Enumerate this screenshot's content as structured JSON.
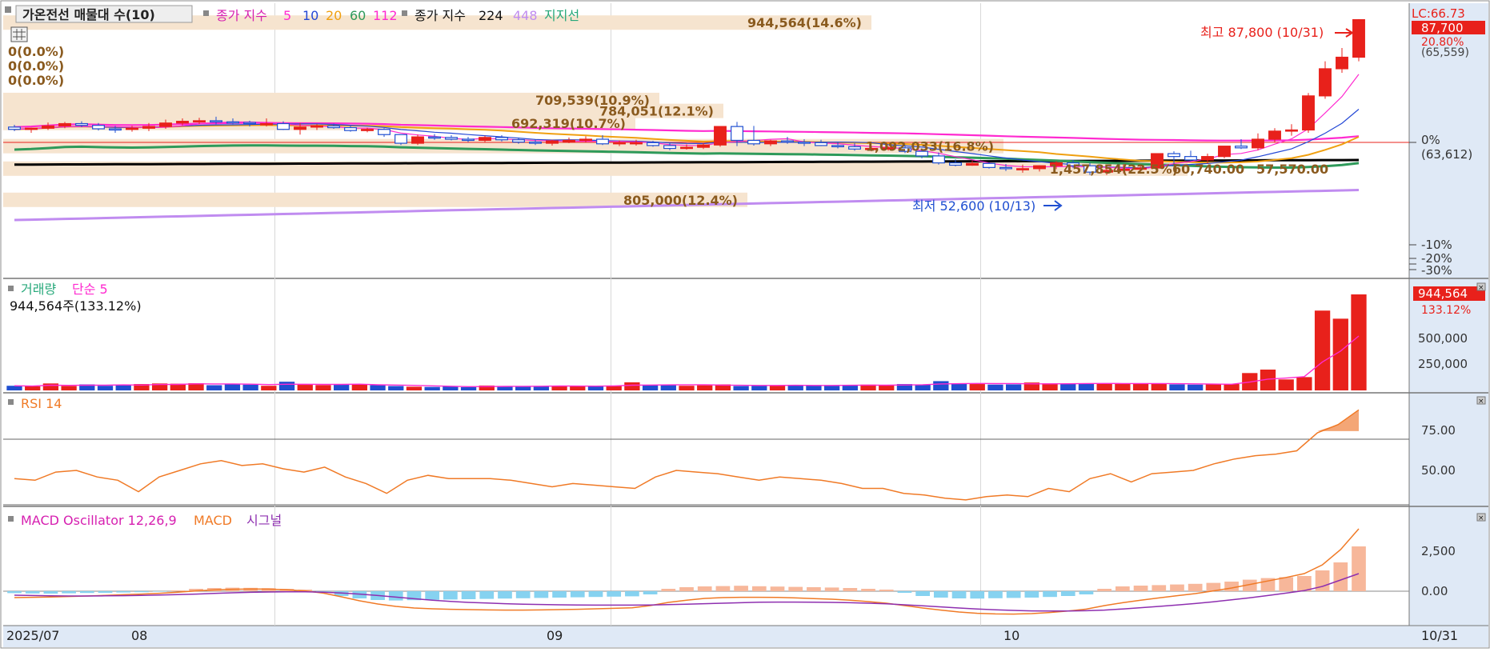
{
  "colors": {
    "up": "#e8211b",
    "down": "#1f4fd1",
    "ma5": "#ff2ad0",
    "ma10": "#2448d6",
    "ma20": "#f0a010",
    "ma60": "#2e9a5a",
    "ma112": "#ff2ad0",
    "ma224": "#000000",
    "ma448": "#c08cf0",
    "support": "#26a87a",
    "vp_band": "#f6e4cf",
    "vp_text": "#8a5a1e",
    "rsi": "#f07a26",
    "rsi_fill": "#f4a676",
    "macd": "#f07a26",
    "signal": "#8e2fb0",
    "osc_pos": "#f7b79a",
    "osc_neg": "#86d2f0",
    "axis_bg": "#dfe9f6"
  },
  "price_panel": {
    "legend": {
      "title": "가온전선 매물대 수(10)",
      "ma_label_a": "종가 지수",
      "ma_vals_a": [
        "5",
        "10",
        "20",
        "60",
        "112"
      ],
      "ma_label_b": "종가 지수",
      "ma_vals_b": [
        "224",
        "448"
      ],
      "support_label": "지지선"
    },
    "grid_icon": "grid-icon",
    "zero_rows": [
      "0(0.0%)",
      "0(0.0%)",
      "0(0.0%)"
    ],
    "high_annot": "최고 87,800 (10/31)",
    "low_annot": "최저 52,600 (10/13)",
    "right_axis": {
      "lc_label": "LC:66.73",
      "cur_price": "87,700",
      "cur_pct": "20.80%",
      "cur_paren": "(65,559)",
      "zero_pct": "0%",
      "zero_paren": "(63,612)",
      "m10": "-10%",
      "m20": "-20%",
      "m30": "-30%"
    },
    "volume_profile": [
      {
        "label": "944,564(14.6%)",
        "price": 87200
      },
      {
        "label": "709,539(10.9%)",
        "price": 73800
      },
      {
        "label": "784,051(12.1%)",
        "price": 71900
      },
      {
        "label": "692,319(10.7%)",
        "price": 69800
      },
      {
        "label": "1,092,033(16.8%)",
        "price": 65800
      },
      {
        "label": "1,457,854(22.5%)",
        "price": 61900
      },
      {
        "label": "60,740.00",
        "price": 61900
      },
      {
        "label": "57,570.00",
        "price": 61900
      },
      {
        "label": "805,000(12.4%)",
        "price": 56500
      }
    ]
  },
  "volume_panel": {
    "label": "거래량",
    "ma_label": "단순 5",
    "current": "944,564주(133.12%)",
    "right": {
      "cur": "944,564",
      "pct": "133.12%",
      "t500k": "500,000",
      "t250k": "250,000"
    }
  },
  "rsi_panel": {
    "label": "RSI 14",
    "t75": "75.00",
    "t50": "50.00"
  },
  "macd_panel": {
    "label": "MACD Oscillator 12,26,9",
    "macd_label": "MACD",
    "signal_label": "시그널",
    "t2500": "2,500",
    "t0": "0.00"
  },
  "x_axis": {
    "labels": [
      "2025/07",
      "08",
      "09",
      "10"
    ],
    "end": "10/31"
  },
  "chart_data": [
    {
      "type": "candlestick",
      "title": "가온전선",
      "x": [
        "07/10",
        "07/11",
        "07/14",
        "07/15",
        "07/16",
        "07/17",
        "07/18",
        "07/21",
        "07/22",
        "07/23",
        "07/24",
        "07/25",
        "07/28",
        "07/29",
        "07/30",
        "07/31",
        "08/01",
        "08/04",
        "08/05",
        "08/06",
        "08/07",
        "08/08",
        "08/11",
        "08/12",
        "08/13",
        "08/14",
        "08/18",
        "08/19",
        "08/20",
        "08/21",
        "08/22",
        "08/25",
        "08/26",
        "08/27",
        "08/28",
        "08/29",
        "09/01",
        "09/02",
        "09/03",
        "09/04",
        "09/05",
        "09/08",
        "09/09",
        "09/10",
        "09/11",
        "09/12",
        "09/15",
        "09/16",
        "09/17",
        "09/18",
        "09/19",
        "09/22",
        "09/23",
        "09/24",
        "09/25",
        "09/26",
        "09/29",
        "09/30",
        "10/01",
        "10/02",
        "10/03",
        "10/06",
        "10/07",
        "10/08",
        "10/09",
        "10/10",
        "10/13",
        "10/14",
        "10/15",
        "10/16",
        "10/17",
        "10/20",
        "10/21",
        "10/22",
        "10/23",
        "10/24",
        "10/27",
        "10/28",
        "10/29",
        "10/30",
        "10/31"
      ],
      "open": [
        69100,
        68700,
        68900,
        69300,
        69700,
        69400,
        68800,
        68700,
        68900,
        69200,
        69800,
        70100,
        70200,
        70000,
        69900,
        69700,
        69700,
        68700,
        69100,
        69300,
        69000,
        68500,
        68700,
        67800,
        66300,
        67400,
        67300,
        67000,
        66800,
        67300,
        66900,
        66500,
        66300,
        66700,
        66800,
        67000,
        66200,
        66400,
        66400,
        65900,
        65400,
        65600,
        66000,
        69200,
        66800,
        66200,
        66700,
        66500,
        66400,
        65900,
        65700,
        65300,
        65400,
        65500,
        64900,
        64100,
        62900,
        62500,
        62800,
        62100,
        61900,
        61900,
        62400,
        62900,
        62400,
        61300,
        61600,
        61800,
        62000,
        64500,
        64000,
        63400,
        64000,
        65800,
        65500,
        67000,
        68400,
        68600,
        74500,
        79200,
        81200
      ],
      "high": [
        69500,
        69000,
        69900,
        70000,
        70100,
        69800,
        69300,
        69300,
        69800,
        70400,
        70600,
        70700,
        70900,
        70600,
        70200,
        70600,
        70100,
        69800,
        69600,
        69700,
        69300,
        69000,
        68900,
        67800,
        67800,
        67900,
        67700,
        67400,
        67600,
        67700,
        67300,
        67000,
        66900,
        67300,
        67500,
        67700,
        66800,
        66900,
        66700,
        66300,
        66100,
        66300,
        67000,
        70000,
        69300,
        66900,
        67400,
        67000,
        66900,
        66500,
        66300,
        65800,
        65800,
        66000,
        65400,
        64700,
        63500,
        63300,
        63000,
        62700,
        62600,
        62500,
        63200,
        63400,
        62900,
        62400,
        62700,
        62500,
        63700,
        64900,
        65000,
        64500,
        65600,
        67000,
        68000,
        68900,
        69600,
        75000,
        80500,
        82800,
        87800
      ],
      "low": [
        68400,
        68100,
        68600,
        68900,
        69100,
        68500,
        68100,
        68300,
        68400,
        68800,
        69400,
        69600,
        69600,
        69600,
        69200,
        69200,
        68600,
        67800,
        68600,
        68800,
        68300,
        68200,
        67400,
        66000,
        66000,
        66900,
        66800,
        66500,
        66400,
        66600,
        66200,
        66000,
        65900,
        66300,
        66500,
        66000,
        65800,
        65900,
        65700,
        65100,
        65200,
        65300,
        65700,
        65800,
        65900,
        65800,
        66200,
        65800,
        65800,
        65400,
        65000,
        64900,
        65000,
        64600,
        63700,
        62600,
        62300,
        62400,
        61900,
        61500,
        61200,
        61400,
        61800,
        62000,
        60800,
        60800,
        61100,
        61300,
        61500,
        62500,
        63200,
        62800,
        63700,
        65300,
        65100,
        66400,
        67600,
        68100,
        74000,
        78500,
        80500
      ],
      "close": [
        68700,
        68900,
        69300,
        69700,
        69400,
        68800,
        68700,
        68900,
        69200,
        69800,
        70100,
        70200,
        70000,
        69900,
        69700,
        69700,
        68700,
        69100,
        69300,
        69000,
        68500,
        68700,
        67800,
        66300,
        67400,
        67300,
        67000,
        66800,
        67300,
        66900,
        66500,
        66300,
        66700,
        66800,
        67000,
        66200,
        66400,
        66400,
        65900,
        65400,
        65600,
        66000,
        69200,
        66800,
        66200,
        66700,
        66500,
        66400,
        65900,
        65700,
        65300,
        65400,
        65500,
        64900,
        64100,
        62900,
        62500,
        62800,
        62100,
        61900,
        61900,
        62400,
        62900,
        62400,
        61300,
        61600,
        61800,
        62000,
        64500,
        64000,
        63400,
        64000,
        65800,
        65500,
        67000,
        68400,
        68600,
        74500,
        79200,
        81200,
        87700
      ]
    },
    {
      "type": "bar",
      "title": "거래량",
      "categories": "same-as-price",
      "values": [
        40000,
        35000,
        60000,
        38000,
        52000,
        40000,
        48000,
        55000,
        60000,
        58000,
        62000,
        45000,
        55000,
        50000,
        40000,
        75000,
        48000,
        46000,
        50000,
        52000,
        45000,
        38000,
        32000,
        30000,
        35000,
        28000,
        42000,
        38000,
        35000,
        37000,
        38000,
        40000,
        35000,
        42000,
        70000,
        45000,
        48000,
        40000,
        44000,
        52000,
        38000,
        40000,
        42000,
        48000,
        46000,
        40000,
        44000,
        50000,
        46000,
        55000,
        50000,
        80000,
        60000,
        55000,
        50000,
        52000,
        68000,
        60000,
        56000,
        60000,
        58000,
        62000,
        60000,
        58000,
        52000,
        50000,
        52000,
        55000,
        150000,
        180000,
        95000,
        115000,
        690000,
        620000,
        830000
      ]
    },
    {
      "type": "line",
      "title": "RSI 14",
      "ylim": [
        30,
        95
      ],
      "values": [
        46,
        45,
        50,
        51,
        47,
        45,
        38,
        47,
        51,
        55,
        57,
        54,
        55,
        52,
        50,
        53,
        47,
        43,
        37,
        45,
        48,
        46,
        46,
        46,
        45,
        43,
        41,
        43,
        42,
        41,
        40,
        47,
        51,
        50,
        49,
        47,
        45,
        47,
        46,
        45,
        43,
        40,
        40,
        37,
        36,
        34,
        33,
        35,
        36,
        35,
        40,
        38,
        46,
        49,
        44,
        49,
        50,
        51,
        55,
        58,
        60,
        61,
        63,
        74,
        79,
        88
      ]
    },
    {
      "type": "bar",
      "title": "MACD Oscillator 12,26,9",
      "values": [
        -120,
        -140,
        -150,
        -130,
        -110,
        -100,
        -80,
        -60,
        -30,
        50,
        150,
        200,
        220,
        210,
        190,
        150,
        100,
        -80,
        -300,
        -450,
        -550,
        -580,
        -560,
        -540,
        -520,
        -500,
        -480,
        -460,
        -440,
        -420,
        -400,
        -380,
        -360,
        -340,
        -320,
        -200,
        150,
        250,
        300,
        320,
        340,
        310,
        290,
        270,
        250,
        230,
        200,
        150,
        100,
        -100,
        -300,
        -400,
        -450,
        -460,
        -440,
        -420,
        -400,
        -360,
        -300,
        -200,
        150,
        300,
        350,
        380,
        420,
        460,
        520,
        600,
        720,
        820,
        880,
        950,
        1300,
        1800,
        2800
      ],
      "macd": [
        -400,
        -380,
        -360,
        -330,
        -300,
        -260,
        -220,
        -180,
        -130,
        -60,
        20,
        80,
        120,
        140,
        130,
        90,
        20,
        -120,
        -350,
        -600,
        -800,
        -950,
        -1050,
        -1100,
        -1130,
        -1150,
        -1170,
        -1180,
        -1180,
        -1170,
        -1150,
        -1130,
        -1100,
        -1070,
        -1040,
        -900,
        -700,
        -560,
        -450,
        -400,
        -380,
        -380,
        -390,
        -420,
        -460,
        -500,
        -560,
        -650,
        -750,
        -900,
        -1050,
        -1180,
        -1300,
        -1380,
        -1420,
        -1430,
        -1400,
        -1330,
        -1240,
        -1120,
        -900,
        -720,
        -560,
        -420,
        -280,
        -150,
        20,
        200,
        420,
        640,
        860,
        1100,
        1650,
        2600,
        3900
      ],
      "signal": [
        -250,
        -270,
        -290,
        -300,
        -300,
        -290,
        -280,
        -260,
        -240,
        -210,
        -180,
        -140,
        -100,
        -70,
        -50,
        -40,
        -40,
        -60,
        -110,
        -180,
        -270,
        -370,
        -470,
        -560,
        -640,
        -700,
        -740,
        -780,
        -810,
        -830,
        -850,
        -860,
        -870,
        -870,
        -870,
        -860,
        -840,
        -810,
        -780,
        -750,
        -720,
        -690,
        -680,
        -680,
        -690,
        -700,
        -720,
        -750,
        -790,
        -850,
        -910,
        -980,
        -1050,
        -1110,
        -1160,
        -1200,
        -1230,
        -1240,
        -1240,
        -1220,
        -1180,
        -1110,
        -1030,
        -950,
        -860,
        -770,
        -660,
        -540,
        -410,
        -270,
        -120,
        40,
        300,
        700,
        1100
      ]
    }
  ]
}
